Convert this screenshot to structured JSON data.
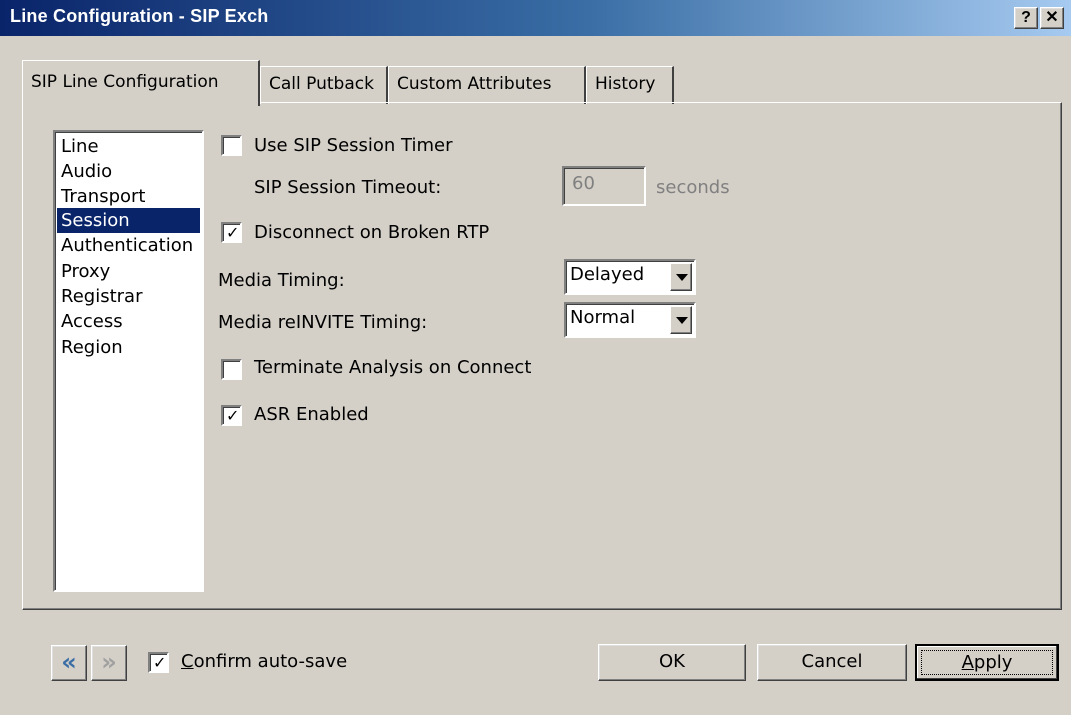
{
  "window": {
    "title": "Line Configuration - SIP Exch",
    "help_label": "?",
    "close_label": "✕"
  },
  "tabs": [
    {
      "label": "SIP Line Configuration"
    },
    {
      "label": "Call Putback"
    },
    {
      "label": "Custom Attributes"
    },
    {
      "label": "History"
    }
  ],
  "categories": {
    "items": [
      "Line",
      "Audio",
      "Transport",
      "Session",
      "Authentication",
      "Proxy",
      "Registrar",
      "Access",
      "Region"
    ],
    "selected": "Session"
  },
  "session": {
    "use_timer_label": "Use SIP Session Timer",
    "use_timer_checked": false,
    "timeout_label": "SIP Session Timeout:",
    "timeout_value": "60",
    "timeout_unit": "seconds",
    "disconnect_label": "Disconnect on Broken RTP",
    "disconnect_checked": true,
    "media_timing_label": "Media Timing:",
    "media_timing_value": "Delayed",
    "reinvite_label": "Media reINVITE Timing:",
    "reinvite_value": "Normal",
    "terminate_label": "Terminate Analysis on Connect",
    "terminate_checked": false,
    "asr_label": "ASR Enabled",
    "asr_checked": true
  },
  "footer": {
    "confirm_prefix": "",
    "confirm_mnemonic": "C",
    "confirm_rest": "onfirm auto-save",
    "confirm_checked": true,
    "ok_label": "OK",
    "cancel_label": "Cancel",
    "apply_mnemonic": "A",
    "apply_rest": "pply"
  },
  "colors": {
    "titlebar_start": "#0a246a",
    "selection": "#0a246a",
    "nav_back_icon": "#3a6ea5"
  },
  "icons": {
    "back": "double-chevron-left-icon",
    "forward": "double-chevron-right-icon",
    "check": "checkmark-icon"
  }
}
